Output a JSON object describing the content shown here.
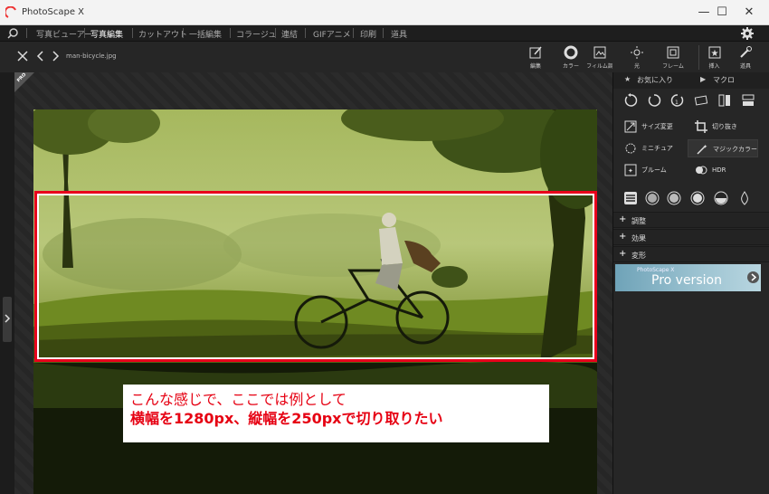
{
  "window": {
    "title": "PhotoScape X",
    "minimize": "—",
    "maximize": "☐",
    "close": "✕"
  },
  "menu": {
    "tabs": [
      "写真ビューアー",
      "写真編集",
      "カットアウト",
      "一括編集",
      "コラージュ",
      "連結",
      "GIFアニメ",
      "印刷",
      "道具"
    ],
    "active_tab": "写真編集"
  },
  "toolbar": {
    "filename": "man-bicycle.jpg",
    "tools": [
      "編集",
      "カラー",
      "フィルム調",
      "光",
      "フレーム"
    ]
  },
  "right_tools": [
    "挿入",
    "道具"
  ],
  "panel": {
    "favorites": "お気に入り",
    "macro": "マクロ",
    "features": [
      {
        "label": "サイズ変更",
        "icon": "resize-icon"
      },
      {
        "label": "切り抜き",
        "icon": "crop-icon"
      },
      {
        "label": "ミニチュア",
        "icon": "miniature-icon"
      },
      {
        "label": "マジックカラー",
        "icon": "magic-wand-icon"
      },
      {
        "label": "ブルーム",
        "icon": "bloom-icon"
      },
      {
        "label": "HDR",
        "icon": "hdr-icon"
      }
    ],
    "sections": [
      "調整",
      "効果",
      "変形"
    ],
    "pro_banner": {
      "small": "PhotoScape X",
      "big": "Pro version"
    }
  },
  "badge": "PRO",
  "annotation": {
    "line1": "こんな感じで、ここでは例として",
    "line2": "横幅を1280px、縦幅を250pxで切り取りたい",
    "color": "#e60012"
  },
  "colors": {
    "crop_border": "#e8001c",
    "panel_bg": "#262626"
  }
}
